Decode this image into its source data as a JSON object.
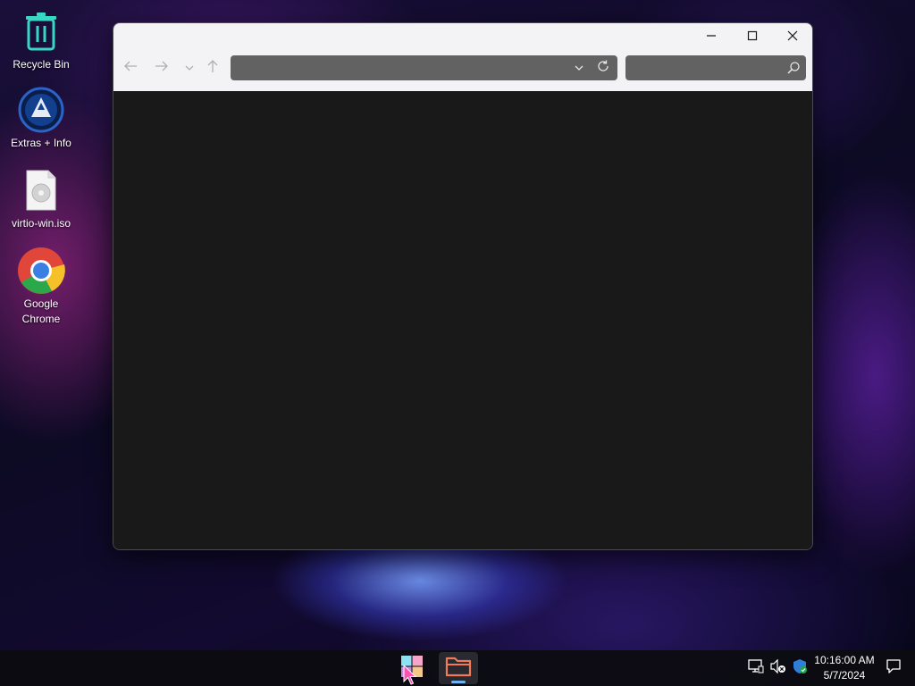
{
  "desktop": {
    "icons": [
      {
        "label": "Recycle Bin",
        "icon": "recycle-bin-icon"
      },
      {
        "label": "Extras + Info",
        "icon": "extras-info-icon"
      },
      {
        "label": "virtio-win.iso",
        "icon": "disc-image-file-icon"
      },
      {
        "label": "Google Chrome",
        "icon": "chrome-icon"
      }
    ]
  },
  "explorer": {
    "address_value": "",
    "search_value": "",
    "icons": [
      "back-arrow-icon",
      "forward-arrow-icon",
      "chevron-down-icon",
      "up-arrow-icon",
      "refresh-icon",
      "search-icon",
      "minimize-icon",
      "maximize-icon",
      "close-icon"
    ]
  },
  "taskbar": {
    "apps": [
      {
        "name": "start",
        "icon": "windows-logo-icon",
        "active": false
      },
      {
        "name": "file-explorer",
        "icon": "folder-icon",
        "active": true
      }
    ],
    "tray_icons": [
      "network-icon",
      "volume-muted-icon",
      "security-shield-icon",
      "notifications-icon"
    ],
    "clock": {
      "time": "10:16:00 AM",
      "date": "5/7/2024"
    }
  },
  "colors": {
    "window_chrome": "#f3f2f5",
    "window_body": "#191919",
    "field": "#626262",
    "accent": "#6db3f2"
  }
}
